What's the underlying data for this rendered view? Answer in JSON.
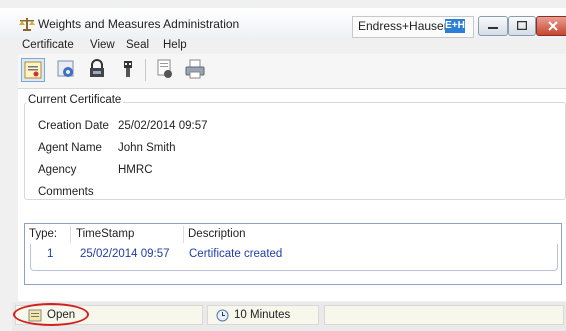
{
  "window": {
    "title": "Weights and Measures Administration",
    "brand": "Endress+Hauser",
    "brand_logo": "E+H",
    "icons": [
      "scales-icon",
      "minimize-icon",
      "maximize-icon",
      "close-icon"
    ]
  },
  "menu": {
    "items": [
      {
        "label": "Certificate"
      },
      {
        "label": "View"
      },
      {
        "label": "Seal"
      },
      {
        "label": "Help"
      }
    ]
  },
  "toolbar": {
    "icons": [
      "certificate-icon",
      "settings-icon",
      "lock-icon",
      "usb-key-icon",
      "report-icon",
      "printer-icon"
    ]
  },
  "certificate": {
    "group_title": "Current Certificate",
    "fields": [
      {
        "label": "Creation Date",
        "value": "25/02/2014 09:57"
      },
      {
        "label": "Agent Name",
        "value": "John Smith"
      },
      {
        "label": "Agency",
        "value": "HMRC"
      },
      {
        "label": "Comments",
        "value": ""
      }
    ]
  },
  "log": {
    "columns": [
      "Type:",
      "TimeStamp",
      "Description"
    ],
    "rows": [
      {
        "type": "1",
        "timestamp": "25/02/2014 09:57",
        "description": "Certificate created"
      }
    ]
  },
  "status": {
    "state": "Open",
    "timeout": "10 Minutes",
    "highlight_color": "#d32020"
  }
}
